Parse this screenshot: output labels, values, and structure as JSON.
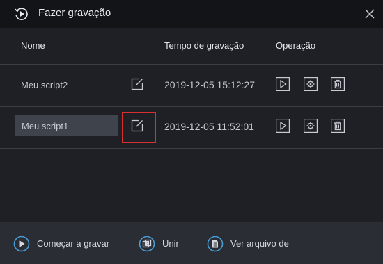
{
  "window": {
    "title": "Fazer gravação",
    "title_icon": "record-replay-icon",
    "close_icon": "close-icon"
  },
  "table": {
    "headers": {
      "name": "Nome",
      "time": "Tempo de gravação",
      "operation": "Operação"
    },
    "rows": [
      {
        "name": "Meu script2",
        "time": "2019-12-05 15:12:27",
        "editing": false
      },
      {
        "name": "Meu script1",
        "time": "2019-12-05 11:52:01",
        "editing": true,
        "edit_highlighted": true
      }
    ],
    "operation_icons": [
      "play-icon",
      "gear-icon",
      "trash-icon"
    ],
    "edit_icon": "edit-icon"
  },
  "footer": {
    "start_label": "Começar a gravar",
    "merge_label": "Unir",
    "view_file_label": "Ver arquivo de"
  },
  "colors": {
    "background": "#1e2026",
    "titlebar": "#131418",
    "footer": "#2a2d34",
    "accent_blue": "#4a9fd8",
    "highlight_red": "#d8302e"
  }
}
